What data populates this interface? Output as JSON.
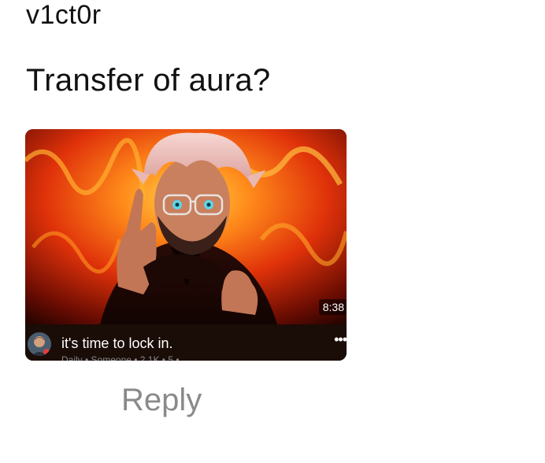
{
  "post": {
    "username": "v1ct0r",
    "text": "Transfer of aura?"
  },
  "video": {
    "duration": "8:38",
    "title": "it's time to lock in.",
    "meta_partial": "Daily • Someone • 2.1K • 5 •",
    "thumbnail_icon": "anime-character-thumbnail",
    "avatar_icon": "channel-avatar-icon",
    "more_icon": "more-options-icon",
    "more_glyph": "•••"
  },
  "actions": {
    "reply_label": "Reply"
  },
  "colors": {
    "accent_fire": "#ff5a10",
    "meta_gray": "#8a8a8a"
  }
}
